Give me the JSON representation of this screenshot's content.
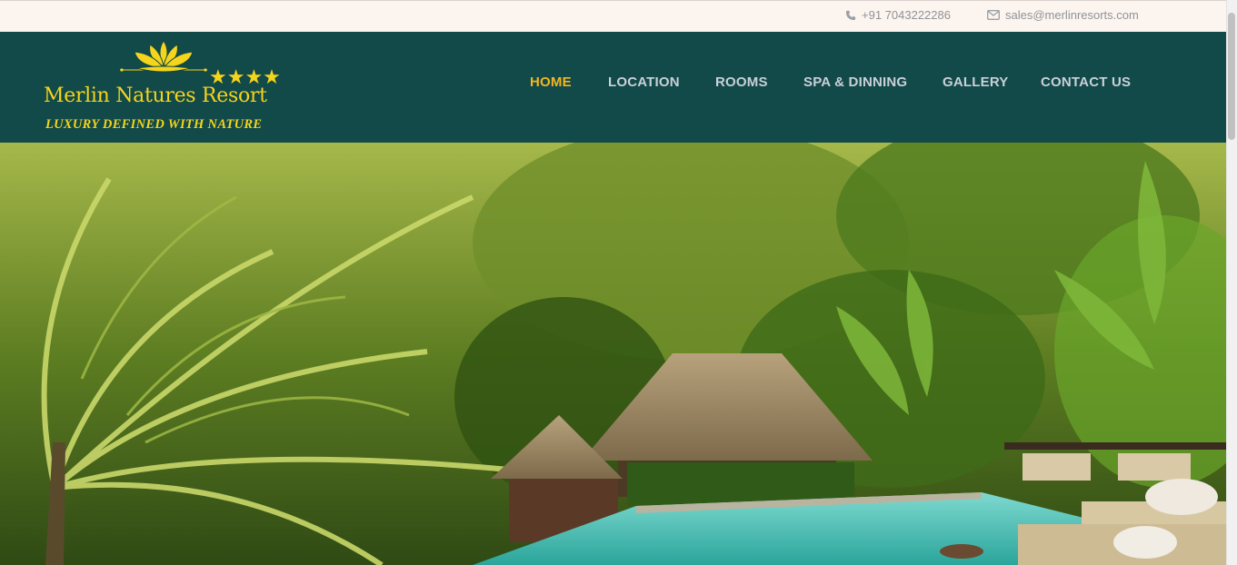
{
  "topbar": {
    "phone": "+91 7043222286",
    "email": "sales@merlinresorts.com",
    "phone_icon": "phone-icon",
    "email_icon": "envelope-icon"
  },
  "logo": {
    "name": "Merlin Natures Resort",
    "stars": "★★★★",
    "tagline": "LUXURY DEFINED WITH NATURE",
    "icon": "lotus-icon"
  },
  "nav": {
    "items": [
      {
        "label": "HOME",
        "active": true
      },
      {
        "label": "LOCATION",
        "active": false
      },
      {
        "label": "ROOMS",
        "active": false
      },
      {
        "label": "SPA & DINNING",
        "active": false
      },
      {
        "label": "GALLERY",
        "active": false
      },
      {
        "label": "CONTACT US",
        "active": false
      }
    ]
  },
  "colors": {
    "header_bg": "#124949",
    "topbar_bg": "#fcf4ee",
    "accent": "#f3b71e",
    "logo_gold": "#f5d51b",
    "nav_text": "#c9d1d8"
  }
}
